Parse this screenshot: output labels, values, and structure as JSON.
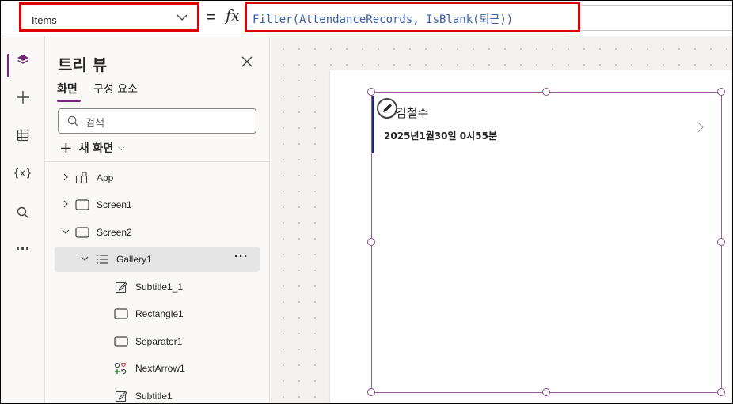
{
  "formula_bar": {
    "property": "Items",
    "equals": "=",
    "fx": "fx",
    "formula": "Filter(AttendanceRecords, IsBlank(퇴근))"
  },
  "rail": {
    "items": [
      {
        "icon": "layers-icon",
        "active": true
      },
      {
        "icon": "plus-icon"
      },
      {
        "icon": "data-table-icon"
      },
      {
        "icon": "variables-icon",
        "label": "{x}"
      },
      {
        "icon": "search-icon"
      },
      {
        "icon": "more-icon",
        "label": "···"
      }
    ]
  },
  "tree": {
    "title": "트리 뷰",
    "tabs": [
      "화면",
      "구성 요소"
    ],
    "search_placeholder": "검색",
    "new_screen": "새 화면",
    "nodes": [
      {
        "label": "App",
        "icon": "app-icon"
      },
      {
        "label": "Screen1",
        "icon": "screen-icon"
      },
      {
        "label": "Screen2",
        "icon": "screen-icon"
      },
      {
        "label": "Gallery1",
        "icon": "gallery-icon",
        "selected": true
      },
      {
        "label": "Subtitle1_1",
        "icon": "edit-label-icon"
      },
      {
        "label": "Rectangle1",
        "icon": "rectangle-icon"
      },
      {
        "label": "Separator1",
        "icon": "rectangle-icon"
      },
      {
        "label": "NextArrow1",
        "icon": "shapes-icon"
      },
      {
        "label": "Subtitle1",
        "icon": "edit-label-icon"
      }
    ]
  },
  "canvas": {
    "gallery_item": {
      "title": "김철수",
      "subtitle": "2025년1월30일 0시55분"
    }
  },
  "colors": {
    "accent": "#742774",
    "highlight_border": "#e00000",
    "formula_text": "#3b5ea8",
    "item_bar": "#1f2370"
  }
}
